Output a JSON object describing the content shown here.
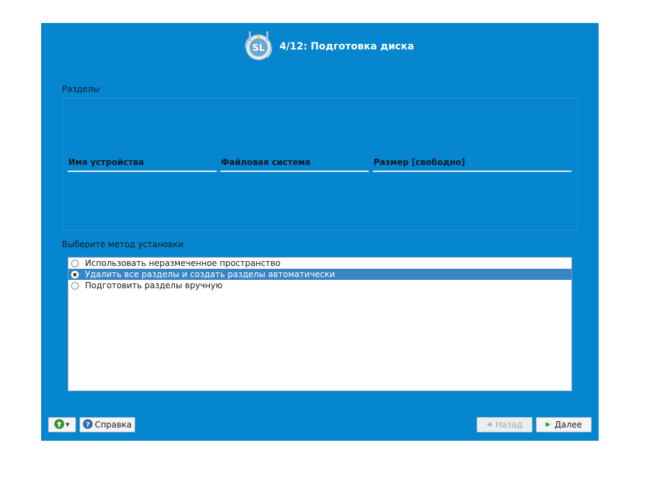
{
  "header": {
    "title": "4/12: Подготовка диска",
    "logo_text": "SL"
  },
  "partitions": {
    "label": "Разделы",
    "columns": [
      "Имя устройства",
      "Файловая система",
      "Размер [свободно]"
    ]
  },
  "method": {
    "label": "Выберите метод установки",
    "options": [
      {
        "label": "Использовать неразмеченное пространство",
        "selected": false
      },
      {
        "label": "Удалить все разделы и создать разделы автоматически",
        "selected": true
      },
      {
        "label": "Подготовить разделы вручную",
        "selected": false
      }
    ]
  },
  "buttons": {
    "help": "Справка",
    "back": "Назад",
    "next": "Далее"
  },
  "icons": {
    "menu": "green-arrow-up-icon",
    "help": "question-mark-icon",
    "back": "chevron-left-icon",
    "next": "chevron-right-icon"
  },
  "colors": {
    "window_bg": "#0586cf",
    "selection": "#3884c4"
  }
}
